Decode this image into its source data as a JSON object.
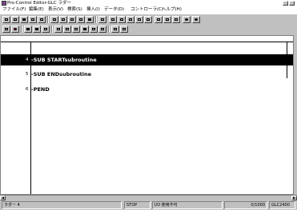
{
  "window": {
    "title": "Pro-Control Editor-GLC ラダー"
  },
  "menu": [
    {
      "label": "ファイル(F)"
    },
    {
      "label": "編集(E)"
    },
    {
      "label": "表示(V)"
    },
    {
      "label": "検索(S)"
    },
    {
      "label": "挿入(I)"
    },
    {
      "label": "データ(D)"
    },
    {
      "label": "コントローラ(C)"
    },
    {
      "label": "ヘルプ(H)"
    }
  ],
  "toolbar1_icons": [
    "new-file-icon",
    "open-folder-icon",
    "save-icon",
    "print-preview-icon",
    "check-icon",
    "undo-icon",
    "cut-icon",
    "copy-icon",
    "paste-icon",
    "find-icon",
    "contact-icon",
    "coil-icon",
    "branch-icon",
    "rung-icon",
    "variable-icon",
    "monitor-icon",
    "settings-icon",
    "compile-icon",
    "run-icon"
  ],
  "toolbar2_icons": [
    "mode-icon",
    "stop-icon",
    "online-icon",
    "offline-icon",
    "download-icon",
    "first-icon",
    "play-icon",
    "fast-forward-icon",
    "stop-square-icon",
    "pause-icon",
    "refresh-icon",
    "help-icon",
    "info-icon"
  ],
  "editor": {
    "rungs": [
      {
        "step": "4",
        "instruction": "SUB STARTsubroutine",
        "selected": true
      },
      {
        "step": "5",
        "instruction": "SUB ENDsubroutine",
        "selected": false
      },
      {
        "step": "6",
        "instruction": "PEND",
        "selected": false
      }
    ]
  },
  "status": {
    "mode_label": "ラダー 4",
    "run_state": "STOP",
    "io_state": "I/O 使用不可",
    "memory": "0/1000",
    "controller": "GLC2400"
  }
}
